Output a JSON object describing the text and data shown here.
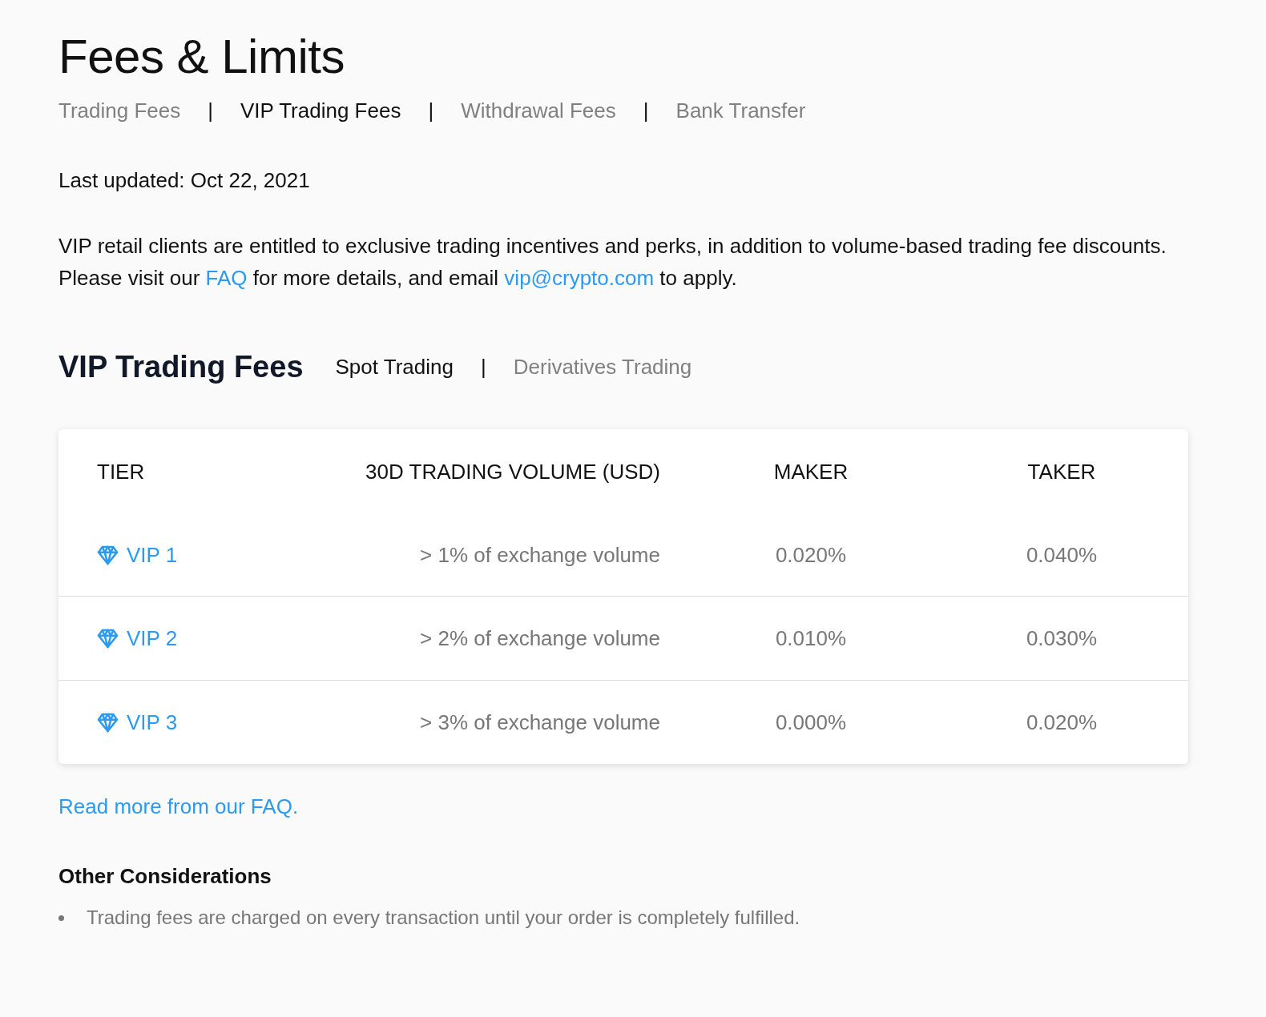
{
  "page": {
    "title": "Fees & Limits"
  },
  "tabs": [
    {
      "kind": "tab",
      "label": "Trading Fees",
      "selected": false
    },
    {
      "kind": "separator",
      "label": "|"
    },
    {
      "kind": "tab",
      "label": "VIP Trading Fees",
      "selected": true
    },
    {
      "kind": "separator",
      "label": "|"
    },
    {
      "kind": "tab",
      "label": "Withdrawal Fees",
      "selected": false
    },
    {
      "kind": "separator",
      "label": "|"
    },
    {
      "kind": "tab",
      "label": "Bank Transfer",
      "selected": false
    }
  ],
  "last_updated": "Last updated: Oct 22, 2021",
  "intro": [
    {
      "kind": "text",
      "text": "VIP retail clients are entitled to exclusive trading incentives and perks, in addition to volume-based trading fee discounts. Please visit our "
    },
    {
      "kind": "link",
      "text": "FAQ"
    },
    {
      "kind": "text",
      "text": " for more details, and email "
    },
    {
      "kind": "link",
      "text": "vip@crypto.com"
    },
    {
      "kind": "text",
      "text": " to apply."
    }
  ],
  "section": {
    "title": "VIP Trading Fees",
    "tabs": [
      {
        "kind": "tab",
        "label": "Spot Trading",
        "selected": true
      },
      {
        "kind": "separator",
        "label": "|"
      },
      {
        "kind": "tab",
        "label": "Derivatives Trading",
        "selected": false
      }
    ]
  },
  "table": {
    "columns": [
      "TIER",
      "30D TRADING VOLUME (USD)",
      "MAKER",
      "TAKER"
    ],
    "rows": [
      {
        "tier": "VIP 1",
        "volume": "> 1% of exchange volume",
        "maker": "0.020%",
        "taker": "0.040%"
      },
      {
        "tier": "VIP 2",
        "volume": "> 2% of exchange volume",
        "maker": "0.010%",
        "taker": "0.030%"
      },
      {
        "tier": "VIP 3",
        "volume": "> 3% of exchange volume",
        "maker": "0.000%",
        "taker": "0.020%"
      }
    ]
  },
  "faq_link": "Read more from our FAQ.",
  "other": {
    "title": "Other Considerations",
    "items": [
      "Trading fees are charged on every transaction until your order is completely fulfilled."
    ]
  }
}
